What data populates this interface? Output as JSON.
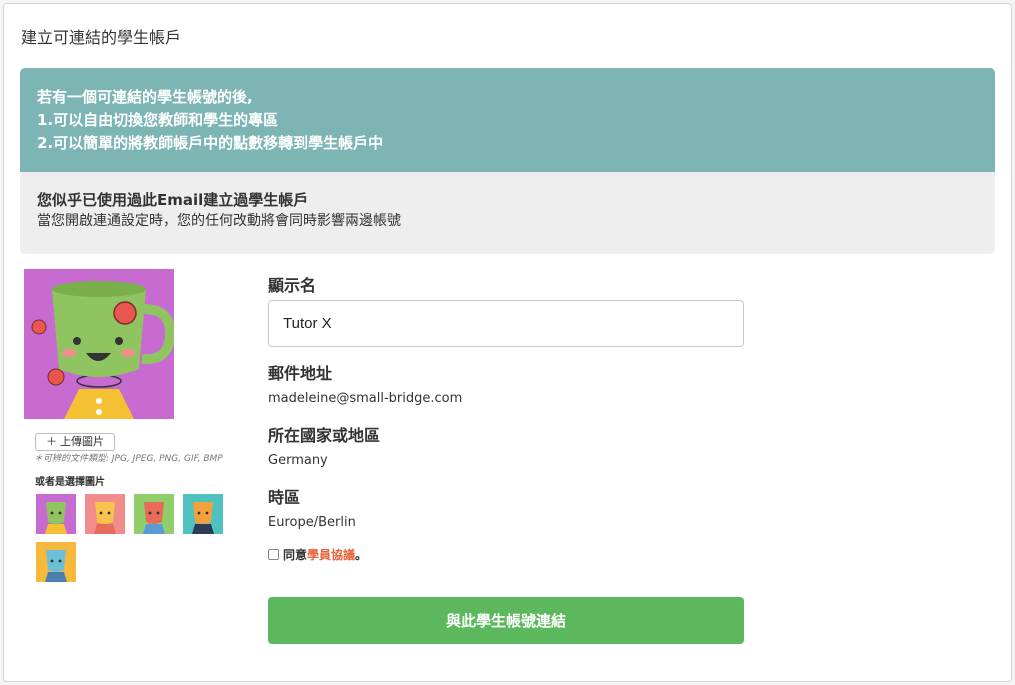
{
  "panel": {
    "title": "建立可連結的學生帳戶"
  },
  "info": {
    "lines": [
      "若有一個可連結的學生帳號的後,",
      "1.可以自由切換您教師和學生的專區",
      "2.可以簡單的將教師帳戶中的點數移轉到學生帳戶中"
    ],
    "notice_title": "您似乎已使用過此Email建立過學生帳戶",
    "notice_text": "當您開啟連通設定時，您的任何改動將會同時影響兩邊帳號"
  },
  "avatar": {
    "upload_label": "＋ 上傳圖片",
    "file_types": "＊可辨的文件類型: JPG, JPEG, PNG, GIF, BMP",
    "choose_label": "或者是選擇圖片",
    "thumbs": [
      {
        "bg": "#c76bd0",
        "cup": "#8fc460"
      },
      {
        "bg": "#f08c8c",
        "cup": "#f6c24b"
      },
      {
        "bg": "#8fce6a",
        "cup": "#e86a5a"
      },
      {
        "bg": "#4fc1be",
        "cup": "#f3a23b"
      },
      {
        "bg": "#f6b93b",
        "cup": "#6cbfd6"
      }
    ]
  },
  "form": {
    "display_name_label": "顯示名",
    "display_name_value": "Tutor X",
    "email_label": "郵件地址",
    "email_value": "madeleine@small-bridge.com",
    "country_label": "所在國家或地區",
    "country_value": "Germany",
    "timezone_label": "時區",
    "timezone_value": "Europe/Berlin",
    "agree_prefix": "同意",
    "agree_link": "學員協議",
    "agree_suffix": "。",
    "submit_label": "與此學生帳號連結"
  },
  "colors": {
    "info_teal": "#7db5b5",
    "accent_green": "#5cb85c",
    "link_orange": "#e8643c"
  }
}
